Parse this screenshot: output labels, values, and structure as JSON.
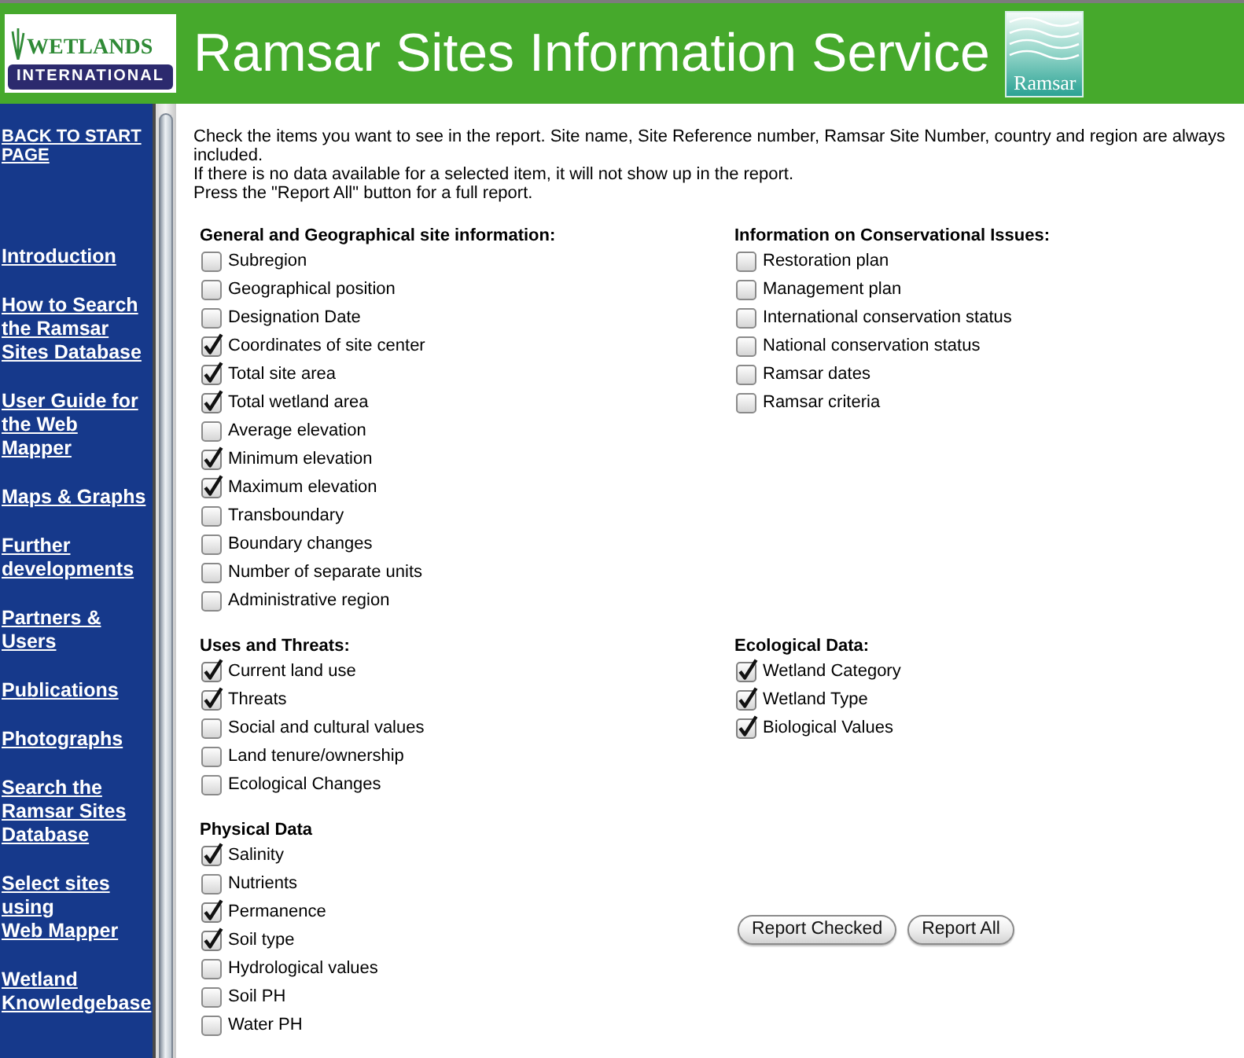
{
  "header": {
    "logo": {
      "name": "WETLANDS",
      "subtitle": "INTERNATIONAL"
    },
    "title": "Ramsar Sites Information Service",
    "partner_logo": {
      "name": "Ramsar"
    }
  },
  "sidebar": {
    "links": [
      {
        "kind": "back",
        "lines": [
          "BACK TO START",
          "PAGE"
        ]
      },
      {
        "kind": "nav",
        "lines": [
          "Introduction"
        ]
      },
      {
        "kind": "nav",
        "lines": [
          "How to Search",
          "the Ramsar",
          "Sites Database"
        ]
      },
      {
        "kind": "nav",
        "lines": [
          "User Guide for",
          "the Web",
          "Mapper"
        ]
      },
      {
        "kind": "nav",
        "lines": [
          "Maps & Graphs"
        ]
      },
      {
        "kind": "nav",
        "lines": [
          "Further",
          "developments"
        ]
      },
      {
        "kind": "nav",
        "lines": [
          "Partners &",
          "Users"
        ]
      },
      {
        "kind": "nav",
        "lines": [
          "Publications"
        ]
      },
      {
        "kind": "nav",
        "lines": [
          "Photographs"
        ]
      },
      {
        "kind": "nav",
        "lines": [
          "Search the",
          "Ramsar Sites",
          "Database"
        ]
      },
      {
        "kind": "nav",
        "lines": [
          "Select sites",
          "using",
          "Web Mapper"
        ]
      },
      {
        "kind": "nav",
        "lines": [
          "Wetland",
          "Knowledgebase"
        ]
      }
    ]
  },
  "intro": [
    "Check the items you want to see in the report. Site name, Site Reference number, Ramsar Site Number, country and region are always included.",
    "If there is no data available for a selected item, it will not show up in the report.",
    "Press the \"Report All\" button for a full report."
  ],
  "sections": [
    {
      "title": "General and Geographical site information:",
      "items": [
        {
          "label": "Subregion",
          "checked": false
        },
        {
          "label": "Geographical position",
          "checked": false
        },
        {
          "label": "Designation Date",
          "checked": false
        },
        {
          "label": "Coordinates of site center",
          "checked": true
        },
        {
          "label": "Total site area",
          "checked": true
        },
        {
          "label": "Total wetland area",
          "checked": true
        },
        {
          "label": "Average elevation",
          "checked": false
        },
        {
          "label": "Minimum elevation",
          "checked": true
        },
        {
          "label": "Maximum elevation",
          "checked": true
        },
        {
          "label": "Transboundary",
          "checked": false
        },
        {
          "label": "Boundary changes",
          "checked": false
        },
        {
          "label": "Number of separate units",
          "checked": false
        },
        {
          "label": "Administrative region",
          "checked": false
        }
      ]
    },
    {
      "title": "Information on Conservational Issues:",
      "items": [
        {
          "label": "Restoration plan",
          "checked": false
        },
        {
          "label": "Management plan",
          "checked": false
        },
        {
          "label": "International conservation status",
          "checked": false
        },
        {
          "label": "National conservation status",
          "checked": false
        },
        {
          "label": "Ramsar dates",
          "checked": false
        },
        {
          "label": "Ramsar criteria",
          "checked": false
        }
      ]
    },
    {
      "title": "Uses and Threats:",
      "items": [
        {
          "label": "Current land use",
          "checked": true
        },
        {
          "label": "Threats",
          "checked": true
        },
        {
          "label": "Social and cultural values",
          "checked": false
        },
        {
          "label": "Land tenure/ownership",
          "checked": false
        },
        {
          "label": "Ecological Changes",
          "checked": false
        }
      ]
    },
    {
      "title": "Ecological Data:",
      "items": [
        {
          "label": "Wetland Category",
          "checked": true
        },
        {
          "label": "Wetland Type",
          "checked": true
        },
        {
          "label": "Biological Values",
          "checked": true
        }
      ]
    },
    {
      "title": "Physical Data",
      "items": [
        {
          "label": "Salinity",
          "checked": true
        },
        {
          "label": "Nutrients",
          "checked": false
        },
        {
          "label": "Permanence",
          "checked": true
        },
        {
          "label": "Soil type",
          "checked": true
        },
        {
          "label": "Hydrological values",
          "checked": false
        },
        {
          "label": "Soil PH",
          "checked": false
        },
        {
          "label": "Water PH",
          "checked": false
        }
      ]
    }
  ],
  "buttons": [
    "Report Checked",
    "Report All"
  ]
}
